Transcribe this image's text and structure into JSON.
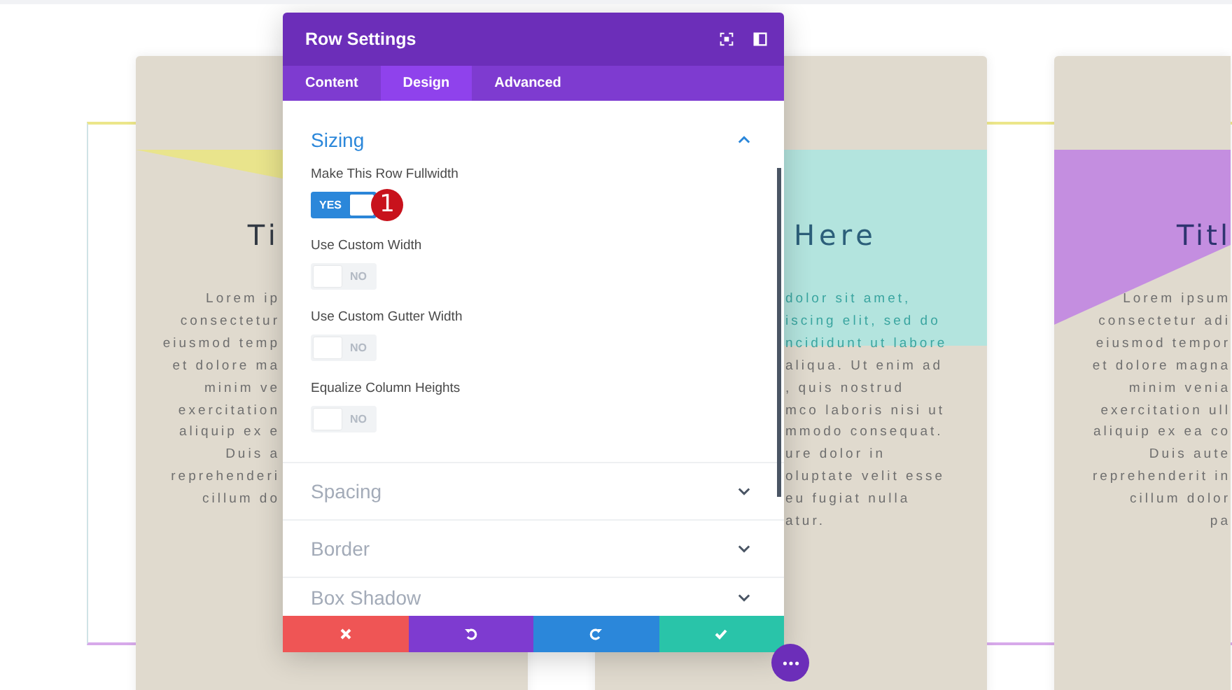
{
  "cards": [
    {
      "kind": "triangle",
      "color": "#e9e48c",
      "title": "Ti",
      "lines": [
        "Lorem ip",
        "consectetur",
        "eiusmod temp",
        "et dolore ma",
        "minim ve",
        "exercitation",
        "aliquip ex e",
        "Duis a",
        "reprehenderi",
        "cillum do"
      ]
    },
    {
      "kind": "band",
      "color": "#b3e4de",
      "title": "Here",
      "lines": [
        "dolor sit amet,",
        "iscing elit, sed do",
        "ncididunt ut labore",
        "aliqua. Ut enim ad",
        ", quis nostrud",
        "mco laboris nisi ut",
        "mmodo consequat.",
        "ure dolor in",
        "oluptate velit esse",
        "eu fugiat nulla",
        "atur."
      ]
    },
    {
      "kind": "slant",
      "color": "#c48ee0",
      "title": "Titl",
      "lines": [
        "Lorem ipsum",
        "consectetur adi",
        "eiusmod tempor",
        "et dolore magna",
        "minim venia",
        "exercitation ull",
        "aliquip ex ea co",
        "Duis aute",
        "reprehenderit in",
        "cillum dolor",
        "pa"
      ]
    }
  ],
  "modal": {
    "title": "Row Settings",
    "tabs": [
      {
        "label": "Content",
        "selected": false
      },
      {
        "label": "Design",
        "selected": true
      },
      {
        "label": "Advanced",
        "selected": false
      }
    ],
    "sections": [
      {
        "title": "Sizing",
        "expanded": true,
        "settings": [
          {
            "label": "Make This Row Fullwidth",
            "on": true,
            "toggle_text": "YES",
            "badge": "1"
          },
          {
            "label": "Use Custom Width",
            "on": false,
            "toggle_text": "NO"
          },
          {
            "label": "Use Custom Gutter Width",
            "on": false,
            "toggle_text": "NO"
          },
          {
            "label": "Equalize Column Heights",
            "on": false,
            "toggle_text": "NO"
          }
        ]
      },
      {
        "title": "Spacing",
        "expanded": false
      },
      {
        "title": "Border",
        "expanded": false
      },
      {
        "title": "Box Shadow",
        "expanded": false
      }
    ],
    "footer_buttons": [
      {
        "kind": "discard"
      },
      {
        "kind": "undo"
      },
      {
        "kind": "redo"
      },
      {
        "kind": "save"
      }
    ]
  }
}
